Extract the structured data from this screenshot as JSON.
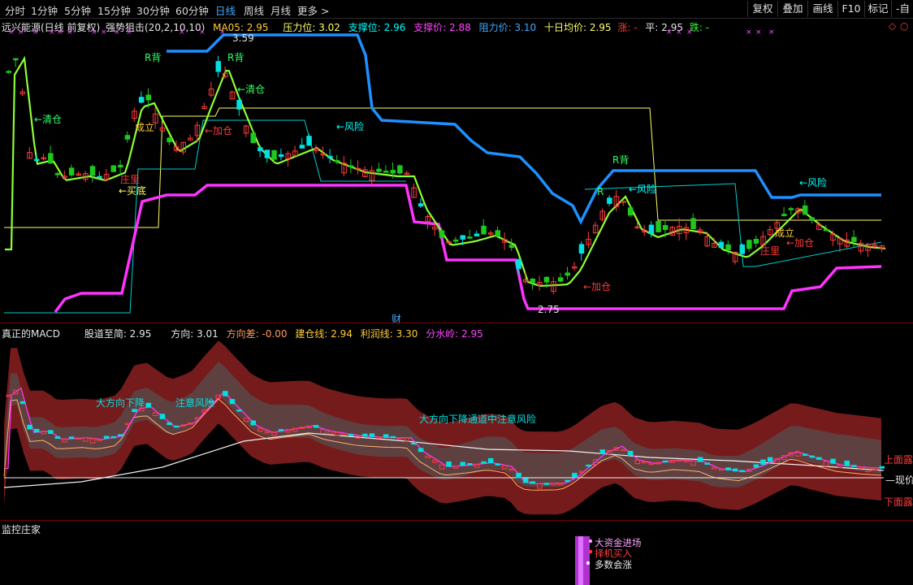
{
  "toolbar": {
    "periods": [
      "分时",
      "1分钟",
      "5分钟",
      "15分钟",
      "30分钟",
      "60分钟",
      "日线",
      "周线",
      "月线",
      "更多 >"
    ],
    "active_period": "日线",
    "buttons": [
      "复权",
      "叠加",
      "画线",
      "F10",
      "标记",
      "-自选"
    ]
  },
  "main_header": {
    "stock": "远兴能源(日线 前复权)",
    "indicator": "强势狙击(20,2,10,10)",
    "ma05": "MA05: 2.95",
    "pressure": "压力位: 3.02",
    "support": "支撑位: 2.96",
    "support_price": "支撑价: 2.88",
    "resistance_price": "阻力价: 3.10",
    "ten_day_avg": "十日均价: 2.95",
    "zhang": "涨: -",
    "ping": "平: 2.95",
    "die": "跌: -"
  },
  "main_labels": {
    "high_price": "3.59",
    "low_price": "2.75",
    "cai": "财",
    "r_bei": "R背",
    "qing_cang": "←清仓",
    "qing_cang2": "清仓",
    "cheng_li": "成立",
    "jia_cang": "←加仓",
    "feng_xian": "←风险",
    "zhu_li": "庄里",
    "mai_di": "←买底",
    "r_small": "R",
    "jia_cang2": "←加仓"
  },
  "macd_header": {
    "name": "真正的MACD",
    "gudao": "股道至简: 2.95",
    "fangxiang": "方向: 3.01",
    "fangxiangcha": "方向差: -0.00",
    "jiancang": "建仓线: 2.94",
    "lirun": "利润线: 3.30",
    "fenshui": "分水岭: 2.95"
  },
  "macd_labels": {
    "trend_text": "大方向下降通道中注意风险",
    "trend_text_short": "大方向下降",
    "trend_text_short2": "注意风险",
    "upper": "上面露",
    "lower": "下面露",
    "current": "现价"
  },
  "monitor": {
    "title": "监控庄家",
    "legend": [
      "大资金进场",
      "择机买入",
      "多数会涨"
    ]
  },
  "colors": {
    "up": "#ff3b3b",
    "down": "#00e0e0",
    "green": "#1ec81e",
    "magenta": "#ff33ff",
    "blue": "#1e90ff",
    "yellow": "#ffff66"
  },
  "chart_data": {
    "type": "candlestick",
    "price_marks": {
      "high": 3.59,
      "low": 2.75
    },
    "current": {
      "ma05": 2.95,
      "pressure": 3.02,
      "support": 2.96,
      "support_price": 2.88,
      "resistance_price": 3.1,
      "ten_day_avg": 2.95
    }
  }
}
